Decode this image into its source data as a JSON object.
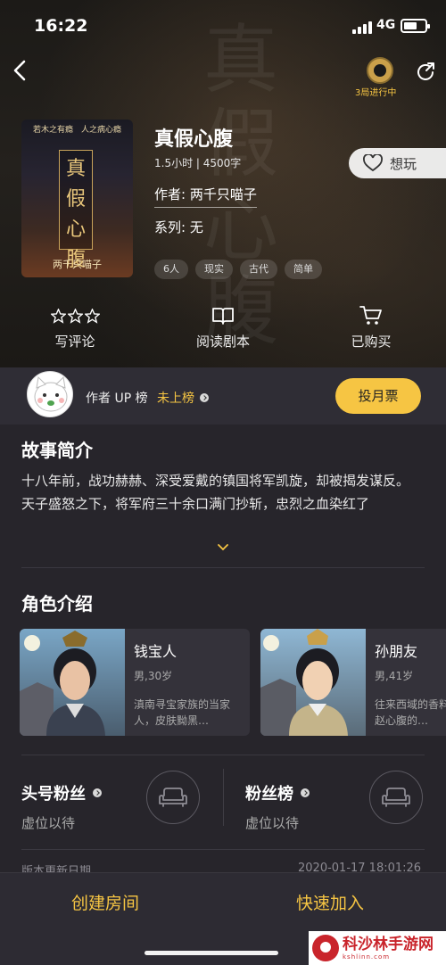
{
  "status_bar": {
    "time": "16:22",
    "network": "4G"
  },
  "header": {
    "progress_label": "3局进行中"
  },
  "script": {
    "cover_tagline": "若木之有瘾　人之病心瘾",
    "cover_title": "真假心腹",
    "cover_author": "两千只喵子",
    "title": "真假心腹",
    "meta": "1.5小时 | 4500字",
    "author": "作者: 两千只喵子",
    "series": "系列: 无",
    "tags": [
      "6人",
      "现实",
      "古代",
      "简单"
    ],
    "want_label": "想玩"
  },
  "actions": [
    {
      "label": "写评论"
    },
    {
      "label": "阅读剧本"
    },
    {
      "label": "已购买"
    }
  ],
  "rank": {
    "title": "作者 UP 榜",
    "value": "未上榜",
    "vote_label": "投月票"
  },
  "synopsis": {
    "heading": "故事简介",
    "text": "十八年前，战功赫赫、深受爱戴的镇国将军凯旋，却被揭发谋反。",
    "text2": "天子盛怒之下，将军府三十余口满门抄斩，忠烈之血染红了"
  },
  "characters": {
    "heading": "角色介绍",
    "items": [
      {
        "name": "钱宝人",
        "info": "男,30岁",
        "desc": "滇南寻宝家族的当家人，皮肤黝黑…"
      },
      {
        "name": "孙朋友",
        "info": "男,41岁",
        "desc": "往来西域的香料商人，赵心腹的…"
      }
    ]
  },
  "fans": {
    "top_fan": {
      "title": "头号粉丝",
      "sub": "虚位以待"
    },
    "fan_list": {
      "title": "粉丝榜",
      "sub": "虚位以待"
    }
  },
  "version": {
    "label": "版本更新日期",
    "date": "2020-01-17 18:01:26"
  },
  "bottom": {
    "create_room": "创建房间",
    "quick_join": "快速加入"
  },
  "watermark": {
    "title": "科沙林手游网",
    "sub": "kshlinn.com"
  }
}
